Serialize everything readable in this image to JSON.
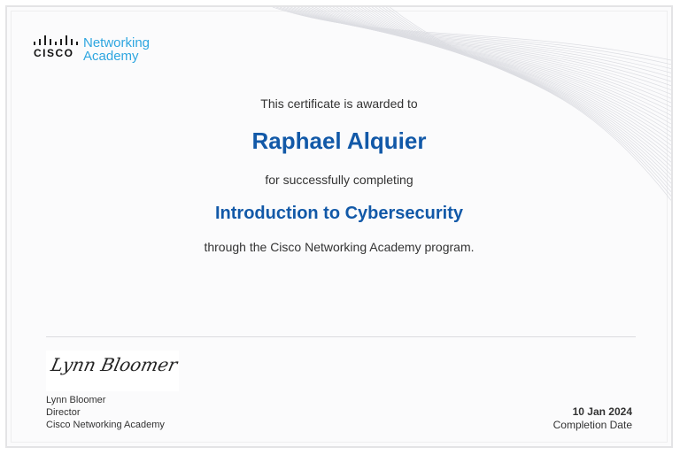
{
  "logo": {
    "brand": "CISCO",
    "line1": "Networking",
    "line2": "Academy",
    "icon": "cisco-bridge-bars-icon"
  },
  "certificate": {
    "intro": "This certificate is awarded to",
    "recipient": "Raphael Alquier",
    "completing": "for successfully completing",
    "course": "Introduction to Cybersecurity",
    "program": "through the Cisco Networking Academy program."
  },
  "signatory": {
    "signature": "Lynn Bloomer",
    "name": "Lynn Bloomer",
    "title": "Director",
    "org": "Cisco Networking Academy"
  },
  "completion": {
    "date": "10 Jan 2024",
    "label": "Completion Date"
  },
  "colors": {
    "accent": "#1259a8",
    "logo_text": "#2ea6e0",
    "text": "#333333"
  }
}
